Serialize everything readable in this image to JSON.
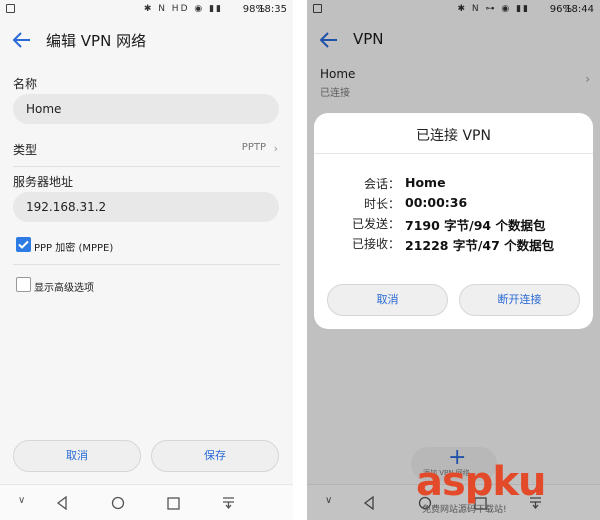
{
  "left": {
    "status": {
      "battery": "98%",
      "time": "18:35",
      "icons": "✱ N HD ◉ ▮▮"
    },
    "title": "编辑 VPN 网络",
    "name_label": "名称",
    "name_value": "Home",
    "type_label": "类型",
    "type_value": "PPTP",
    "server_label": "服务器地址",
    "server_value": "192.168.31.2",
    "ppp_label": "PPP 加密 (MPPE)",
    "ppp_checked": true,
    "advanced_label": "显示高级选项",
    "advanced_checked": false,
    "cancel": "取消",
    "save": "保存"
  },
  "right": {
    "status": {
      "battery": "96%",
      "time": "18:44",
      "icons": "✱ N ⊶ ◉ ▮▮"
    },
    "title": "VPN",
    "item_name": "Home",
    "item_status": "已连接",
    "dialog": {
      "title": "已连接 VPN",
      "rows": [
        {
          "key": "会话：",
          "value": "Home"
        },
        {
          "key": "时长：",
          "value": "00:00:36"
        },
        {
          "key": "已发送：",
          "value": "7190 字节/94 个数据包"
        },
        {
          "key": "已接收：",
          "value": "21228 字节/47 个数据包"
        }
      ],
      "cancel": "取消",
      "disconnect": "断开连接"
    },
    "add_label": "添加 VPN 网络"
  },
  "watermark": {
    "logo": "aspku",
    "sub": "免费网站源码下载站!"
  },
  "colors": {
    "accent": "#2a6ad6",
    "field_bg": "#e8e8e8",
    "logo": "#e34a2a"
  }
}
